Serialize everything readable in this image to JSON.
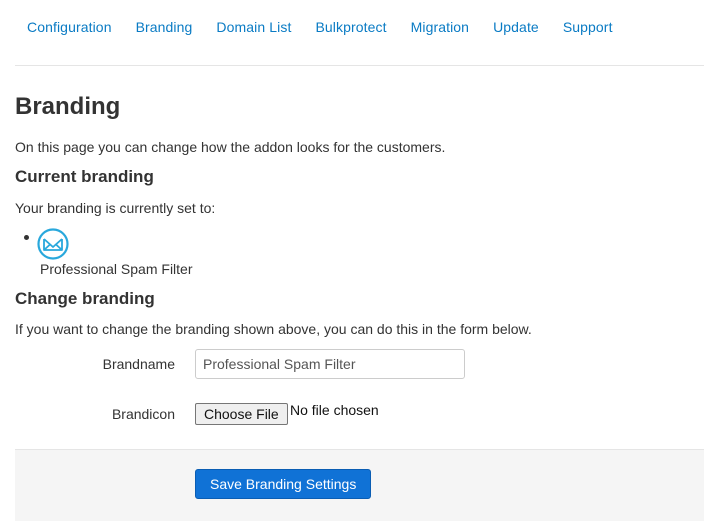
{
  "nav": {
    "items": [
      "Configuration",
      "Branding",
      "Domain List",
      "Bulkprotect",
      "Migration",
      "Update",
      "Support"
    ],
    "link_color": "#0a7bc4"
  },
  "page": {
    "title": "Branding",
    "intro": "On this page you can change how the addon looks for the customers."
  },
  "current_branding": {
    "heading": "Current branding",
    "text": "Your branding is currently set to:",
    "icon": "envelope-logo-icon",
    "name": "Professional Spam Filter"
  },
  "change_branding": {
    "heading": "Change branding",
    "text": "If you want to change the branding shown above, you can do this in the form below.",
    "brandname_label": "Brandname",
    "brandname_value": "Professional Spam Filter",
    "brandicon_label": "Brandicon",
    "choose_file_label": "Choose File",
    "file_status": "No file chosen",
    "save_label": "Save Branding Settings",
    "save_color": "#1072d6"
  }
}
